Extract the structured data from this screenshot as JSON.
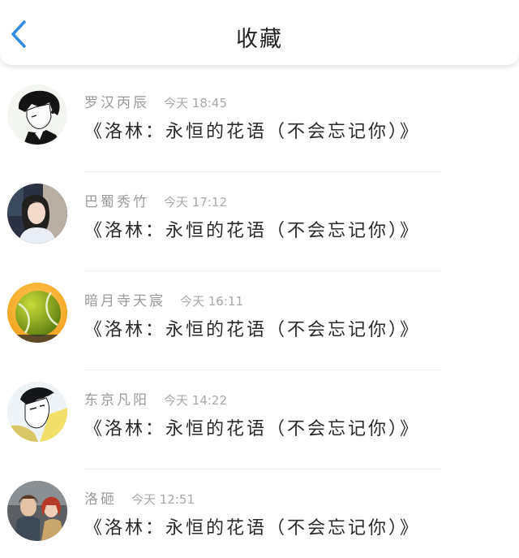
{
  "header": {
    "title": "收藏",
    "back_icon": "chevron-left-icon",
    "accent_color": "#2f8be0"
  },
  "items": [
    {
      "name": "罗汉丙辰",
      "time": "今天 18:45",
      "content": "《洛林：永恒的花语（不会忘记你）》",
      "avatar_icon": "anime-boy-avatar"
    },
    {
      "name": "巴蜀秀竹",
      "time": "今天 17:12",
      "content": "《洛林：永恒的花语（不会忘记你）》",
      "avatar_icon": "girl-photo-avatar"
    },
    {
      "name": "暗月寺天宸",
      "time": "今天 16:11",
      "content": "《洛林：永恒的花语（不会忘记你）》",
      "avatar_icon": "tennis-ball-avatar"
    },
    {
      "name": "东京凡阳",
      "time": "今天 14:22",
      "content": "《洛林：永恒的花语（不会忘记你）》",
      "avatar_icon": "anime-face-avatar"
    },
    {
      "name": "洛砸",
      "time": "今天 12:51",
      "content": "《洛林：永恒的花语（不会忘记你）》",
      "avatar_icon": "game-characters-avatar"
    }
  ]
}
